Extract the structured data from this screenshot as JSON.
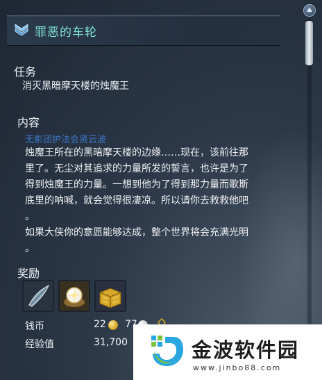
{
  "quest": {
    "title": "罪恶的车轮",
    "task_label": "任务",
    "task_text": "消灭黑暗摩天楼的烛魔王",
    "content_label": "内容",
    "npc_name": "无影团护法会贤云波",
    "description_lines": [
      "烛魔王所在的黑暗摩天楼的边缘……现在，该前往那",
      "里了。无尘对其追求的力量所发的誓言，也许是为了",
      "得到烛魔王的力量。一想到他为了得到那力量而歌斯",
      "底里的呐喊，就会觉得很凄凉。所以请你去救救他吧",
      "。",
      "如果大侠你的意愿能够达成，整个世界将会充满光明",
      "。"
    ],
    "reward_label": "奖励",
    "reward_items": [
      {
        "icon": "feather-blade-icon"
      },
      {
        "icon": "glowing-orb-icon"
      },
      {
        "icon": "treasure-chest-icon"
      }
    ],
    "money_label": "钱币",
    "money_gold": "22",
    "money_silver": "77",
    "exp_label": "经验值",
    "exp_value": "31,700"
  },
  "watermark": {
    "name": "金波软件园",
    "url": "www.jinbo88.com"
  },
  "colors": {
    "title": "#7fe3d4",
    "npc": "#3d79c8",
    "gold_coin": "#d8a928",
    "silver_coin": "#c9ced4"
  }
}
